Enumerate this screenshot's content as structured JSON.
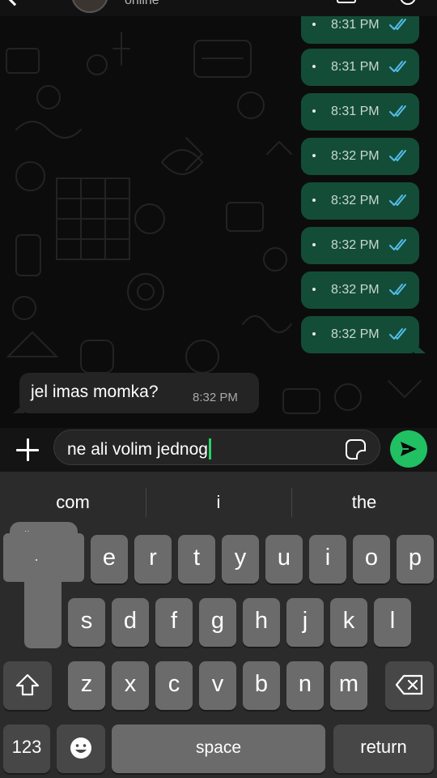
{
  "header": {
    "status": "online"
  },
  "outgoing": [
    {
      "time": "8:31 PM",
      "status": "read"
    },
    {
      "time": "8:31 PM",
      "status": "read"
    },
    {
      "time": "8:31 PM",
      "status": "read"
    },
    {
      "time": "8:32 PM",
      "status": "read"
    },
    {
      "time": "8:32 PM",
      "status": "read"
    },
    {
      "time": "8:32 PM",
      "status": "read"
    },
    {
      "time": "8:32 PM",
      "status": "read"
    },
    {
      "time": "8:32 PM",
      "status": "read"
    }
  ],
  "incoming": {
    "text": "jel imas momka?",
    "time": "8:32 PM"
  },
  "composer": {
    "value": "ne ali volim jednog"
  },
  "keyboard": {
    "suggestions": [
      "com",
      "i",
      "the"
    ],
    "row1": [
      "e",
      "r",
      "t",
      "y",
      "u",
      "i",
      "o",
      "p"
    ],
    "row2": [
      "s",
      "d",
      "f",
      "g",
      "h",
      "j",
      "k",
      "l"
    ],
    "row3": [
      "z",
      "x",
      "c",
      "v",
      "b",
      "n",
      "m"
    ],
    "numbers": "123",
    "space": "space",
    "return": "return"
  },
  "colors": {
    "outgoing_bubble": "#144d37",
    "incoming_bubble": "#242424",
    "read_ticks": "#53bdeb",
    "accent": "#21c063"
  }
}
